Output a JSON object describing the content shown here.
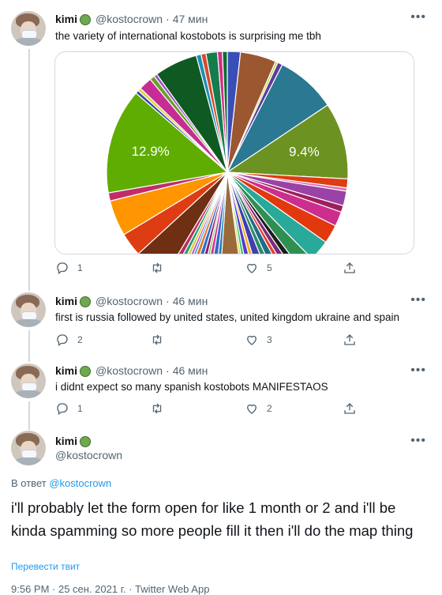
{
  "tweets": [
    {
      "name": "kimi",
      "handle": "@kostocrown",
      "time": "47 мин",
      "text": "the variety of international kostobots is surprising me tbh",
      "replies": "1",
      "retweets": "",
      "likes": "5"
    },
    {
      "name": "kimi",
      "handle": "@kostocrown",
      "time": "46 мин",
      "text": "first is russia followed by united states, united kingdom ukraine and spain",
      "replies": "2",
      "retweets": "",
      "likes": "3"
    },
    {
      "name": "kimi",
      "handle": "@kostocrown",
      "time": "46 мин",
      "text": "i didnt expect so many spanish kostobots MANIFESTAOS",
      "replies": "1",
      "retweets": "",
      "likes": "2"
    }
  ],
  "main": {
    "name": "kimi",
    "handle": "@kostocrown",
    "reply_prefix": "В ответ ",
    "reply_to": "@kostocrown",
    "text": "i'll probably let the form open for like 1 month or 2 and i'll be kinda spamming so more people fill it then i'll do the map thing",
    "translate": "Перевести твит",
    "footer": "9:56 PM · 25 сен. 2021 г. · Twitter Web App"
  },
  "chart_data": {
    "type": "pie",
    "labels": {
      "green_slice": "12.9%",
      "olive_slice": "9.4%"
    },
    "slices": [
      {
        "value": 1.6,
        "color": "#3a4eb8"
      },
      {
        "value": 4.4,
        "color": "#9b5730"
      },
      {
        "value": 0.3,
        "color": "#c9d34a"
      },
      {
        "value": 0.6,
        "color": "#5a3d9a"
      },
      {
        "value": 7.4,
        "color": "#2a7891"
      },
      {
        "value": 9.4,
        "color": "#6c9221",
        "label": "9.4%"
      },
      {
        "value": 1.1,
        "color": "#de3c13"
      },
      {
        "value": 0.4,
        "color": "#e06ab0"
      },
      {
        "value": 1.8,
        "color": "#9b42a6"
      },
      {
        "value": 0.8,
        "color": "#9d1f5a"
      },
      {
        "value": 1.8,
        "color": "#cc2e8e"
      },
      {
        "value": 2.3,
        "color": "#e2380e"
      },
      {
        "value": 2.6,
        "color": "#28a99a"
      },
      {
        "value": 1.8,
        "color": "#2f8f53"
      },
      {
        "value": 0.8,
        "color": "#1d1d1d"
      },
      {
        "value": 0.8,
        "color": "#7a2d7a"
      },
      {
        "value": 0.6,
        "color": "#e93d2e"
      },
      {
        "value": 1.0,
        "color": "#1f6e85"
      },
      {
        "value": 0.8,
        "color": "#2b8d6a"
      },
      {
        "value": 1.2,
        "color": "#3f3fb0"
      },
      {
        "value": 0.6,
        "color": "#f0b023"
      },
      {
        "value": 0.8,
        "color": "#5b36c5"
      },
      {
        "value": 0.5,
        "color": "#28c66e"
      },
      {
        "value": 0.4,
        "color": "#e8d23a"
      },
      {
        "value": 3.0,
        "color": "#9b6a3a"
      },
      {
        "value": 0.6,
        "color": "#1d7fb7"
      },
      {
        "value": 0.8,
        "color": "#3a65c6"
      },
      {
        "value": 0.6,
        "color": "#d3368e"
      },
      {
        "value": 0.4,
        "color": "#6ec86a"
      },
      {
        "value": 0.6,
        "color": "#8e1c6d"
      },
      {
        "value": 0.7,
        "color": "#2d6fca"
      },
      {
        "value": 0.6,
        "color": "#e7722f"
      },
      {
        "value": 0.4,
        "color": "#33a1c9"
      },
      {
        "value": 0.4,
        "color": "#b23ac9"
      },
      {
        "value": 0.5,
        "color": "#e3c33a"
      },
      {
        "value": 0.6,
        "color": "#20a373"
      },
      {
        "value": 0.7,
        "color": "#bf2b63"
      },
      {
        "value": 4.2,
        "color": "#6e2f12"
      },
      {
        "value": 2.9,
        "color": "#de3c13"
      },
      {
        "value": 4.4,
        "color": "#ff9500"
      },
      {
        "value": 1.0,
        "color": "#c22c68"
      },
      {
        "value": 12.9,
        "color": "#5fad00",
        "label": "12.9%"
      },
      {
        "value": 0.4,
        "color": "#3f3fb0"
      },
      {
        "value": 0.4,
        "color": "#d7d734"
      },
      {
        "value": 1.6,
        "color": "#c62c96"
      },
      {
        "value": 0.6,
        "color": "#6b9f2a"
      },
      {
        "value": 0.4,
        "color": "#9b4fc7"
      },
      {
        "value": 5.3,
        "color": "#0f5a22"
      },
      {
        "value": 0.6,
        "color": "#1e8fb8"
      },
      {
        "value": 0.6,
        "color": "#d44c2a"
      },
      {
        "value": 1.4,
        "color": "#157c4c"
      },
      {
        "value": 0.6,
        "color": "#d02f86"
      },
      {
        "value": 0.6,
        "color": "#0f6c33"
      }
    ]
  }
}
